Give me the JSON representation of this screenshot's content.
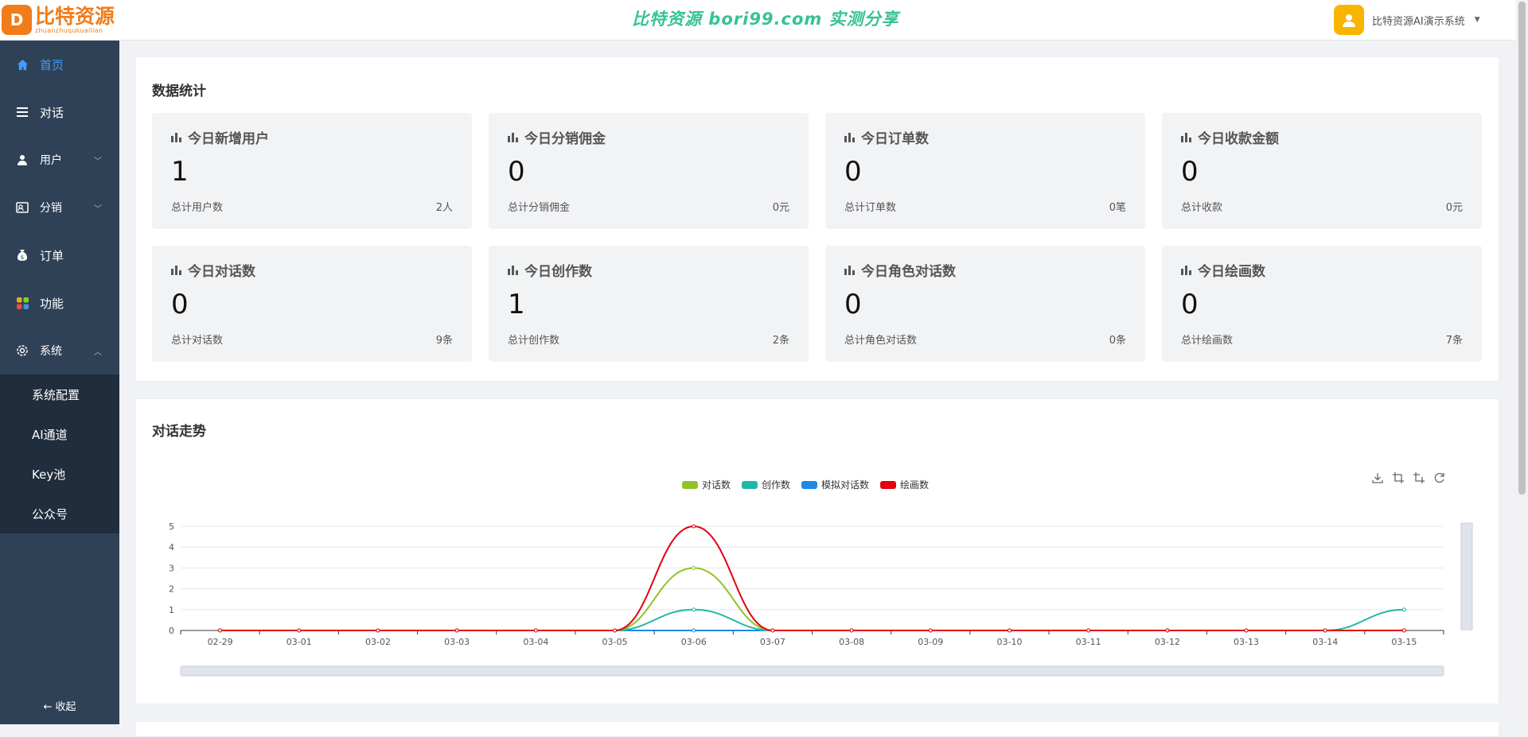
{
  "header": {
    "logo_glyph": "D",
    "logo_title": "比特资源",
    "logo_sub": "zhuanzhuqukuailian",
    "banner": "比特资源 bori99.com 实测分享",
    "user_name": "比特资源AI演示系统"
  },
  "sidebar": {
    "items": [
      {
        "label": "首页",
        "icon": "home-icon"
      },
      {
        "label": "对话",
        "icon": "list-icon"
      },
      {
        "label": "用户",
        "icon": "user-icon"
      },
      {
        "label": "分销",
        "icon": "distribution-icon"
      },
      {
        "label": "订单",
        "icon": "money-bag-icon"
      },
      {
        "label": "功能",
        "icon": "grid-icon"
      },
      {
        "label": "系统",
        "icon": "gear-icon"
      }
    ],
    "sub_items": [
      "系统配置",
      "AI通道",
      "Key池",
      "公众号"
    ],
    "collapse_label": "← 收起"
  },
  "stats": {
    "title": "数据统计",
    "cards": [
      {
        "title": "今日新增用户",
        "value": "1",
        "foot_label": "总计用户数",
        "foot_value": "2人"
      },
      {
        "title": "今日分销佣金",
        "value": "0",
        "foot_label": "总计分销佣金",
        "foot_value": "0元"
      },
      {
        "title": "今日订单数",
        "value": "0",
        "foot_label": "总计订单数",
        "foot_value": "0笔"
      },
      {
        "title": "今日收款金额",
        "value": "0",
        "foot_label": "总计收款",
        "foot_value": "0元"
      },
      {
        "title": "今日对话数",
        "value": "0",
        "foot_label": "总计对话数",
        "foot_value": "9条"
      },
      {
        "title": "今日创作数",
        "value": "1",
        "foot_label": "总计创作数",
        "foot_value": "2条"
      },
      {
        "title": "今日角色对话数",
        "value": "0",
        "foot_label": "总计角色对话数",
        "foot_value": "0条"
      },
      {
        "title": "今日绘画数",
        "value": "0",
        "foot_label": "总计绘画数",
        "foot_value": "7条"
      }
    ]
  },
  "trend": {
    "title": "对话走势"
  },
  "colors": {
    "accent": "#409eff",
    "sidebar_bg": "#2f4156",
    "submenu_bg": "#1f2d3d"
  },
  "chart_data": {
    "type": "line",
    "categories": [
      "02-29",
      "03-01",
      "03-02",
      "03-03",
      "03-04",
      "03-05",
      "03-06",
      "03-07",
      "03-08",
      "03-09",
      "03-10",
      "03-11",
      "03-12",
      "03-13",
      "03-14",
      "03-15"
    ],
    "series": [
      {
        "name": "对话数",
        "color": "#91c22a",
        "values": [
          0,
          0,
          0,
          0,
          0,
          0,
          3,
          0,
          0,
          0,
          0,
          0,
          0,
          0,
          0,
          0
        ]
      },
      {
        "name": "创作数",
        "color": "#20b8a6",
        "values": [
          0,
          0,
          0,
          0,
          0,
          0,
          1,
          0,
          0,
          0,
          0,
          0,
          0,
          0,
          0,
          1
        ]
      },
      {
        "name": "模拟对话数",
        "color": "#1e88e5",
        "values": [
          0,
          0,
          0,
          0,
          0,
          0,
          0,
          0,
          0,
          0,
          0,
          0,
          0,
          0,
          0,
          0
        ]
      },
      {
        "name": "绘画数",
        "color": "#e3000f",
        "values": [
          0,
          0,
          0,
          0,
          0,
          0,
          5,
          0,
          0,
          0,
          0,
          0,
          0,
          0,
          0,
          0
        ]
      }
    ],
    "ylim": [
      0,
      5
    ],
    "yticks": [
      0,
      1,
      2,
      3,
      4,
      5
    ],
    "legend_position": "top-center",
    "grid": true,
    "smooth": true
  }
}
